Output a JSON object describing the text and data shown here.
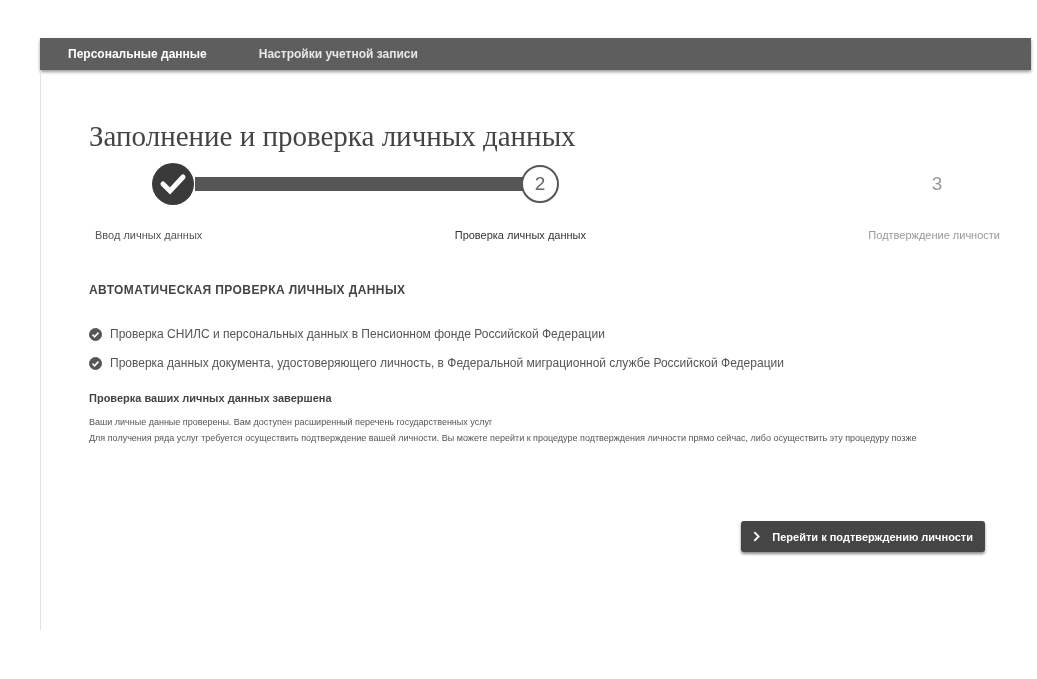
{
  "nav": {
    "tabs": [
      {
        "label": "Персональные данные",
        "selected": true
      },
      {
        "label": "Настройки учетной записи",
        "selected": false
      }
    ]
  },
  "title": "Заполнение и проверка личных данных",
  "steps": [
    {
      "label": "Ввод личных данных",
      "completed": true,
      "selected": false
    },
    {
      "number": "2",
      "label": "Проверка личных данных",
      "completed": false,
      "selected": true
    },
    {
      "number": "3",
      "label": "Подтверждение личности",
      "completed": false,
      "selected": false
    }
  ],
  "section_heading": "АВТОМАТИЧЕСКАЯ ПРОВЕРКА ЛИЧНЫХ ДАННЫХ",
  "checks": [
    {
      "text": "Проверка СНИЛС и персональных данных в Пенсионном фонде Российской Федерации",
      "checked": true
    },
    {
      "text": "Проверка данных документа, удостоверяющего личность, в Федеральной миграционной службе Российской Федерации",
      "checked": true
    }
  ],
  "result_heading": "Проверка ваших личных данных завершена",
  "paragraphs": [
    "Ваши личные данные проверены. Вам доступен расширенный перечень государственных услуг",
    "Для получения ряда услуг требуется осуществить подтверждение вашей личности. Вы можете перейти к процедуре подтверждения личности прямо сейчас, либо осуществить эту процедуру позже"
  ],
  "action_button": "Перейти к подтверждению личности"
}
